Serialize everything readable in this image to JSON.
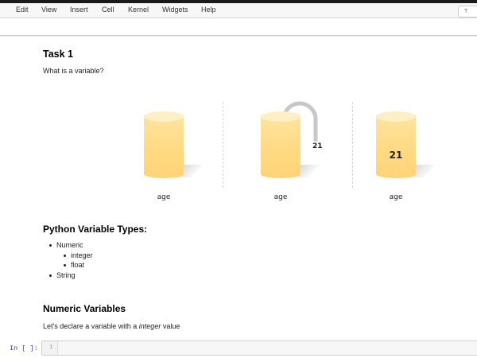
{
  "menubar": {
    "items": [
      "Edit",
      "View",
      "Insert",
      "Cell",
      "Kernel",
      "Widgets",
      "Help"
    ],
    "kernel_indicator": "T"
  },
  "task": {
    "title": "Task 1",
    "question": "What is a variable?"
  },
  "figure": {
    "panels": [
      {
        "label": "age",
        "value": ""
      },
      {
        "label": "age",
        "arrow_value": "21"
      },
      {
        "label": "age",
        "value": "21"
      }
    ],
    "colors": {
      "cylinder": "#ffd980",
      "cylinder_top": "#ffefc2",
      "arrow": "#c8c8c8"
    }
  },
  "types": {
    "title": "Python Variable Types:",
    "items": {
      "numeric": "Numeric",
      "integer": "integer",
      "float": "float",
      "string": "String"
    }
  },
  "numeric_section": {
    "title": "Numeric Variables",
    "text_before": "Let's declare a variable with a ",
    "text_em": "integer",
    "text_after": " value"
  },
  "code_cell": {
    "prompt": "In [ ]:",
    "line_number": "1"
  }
}
